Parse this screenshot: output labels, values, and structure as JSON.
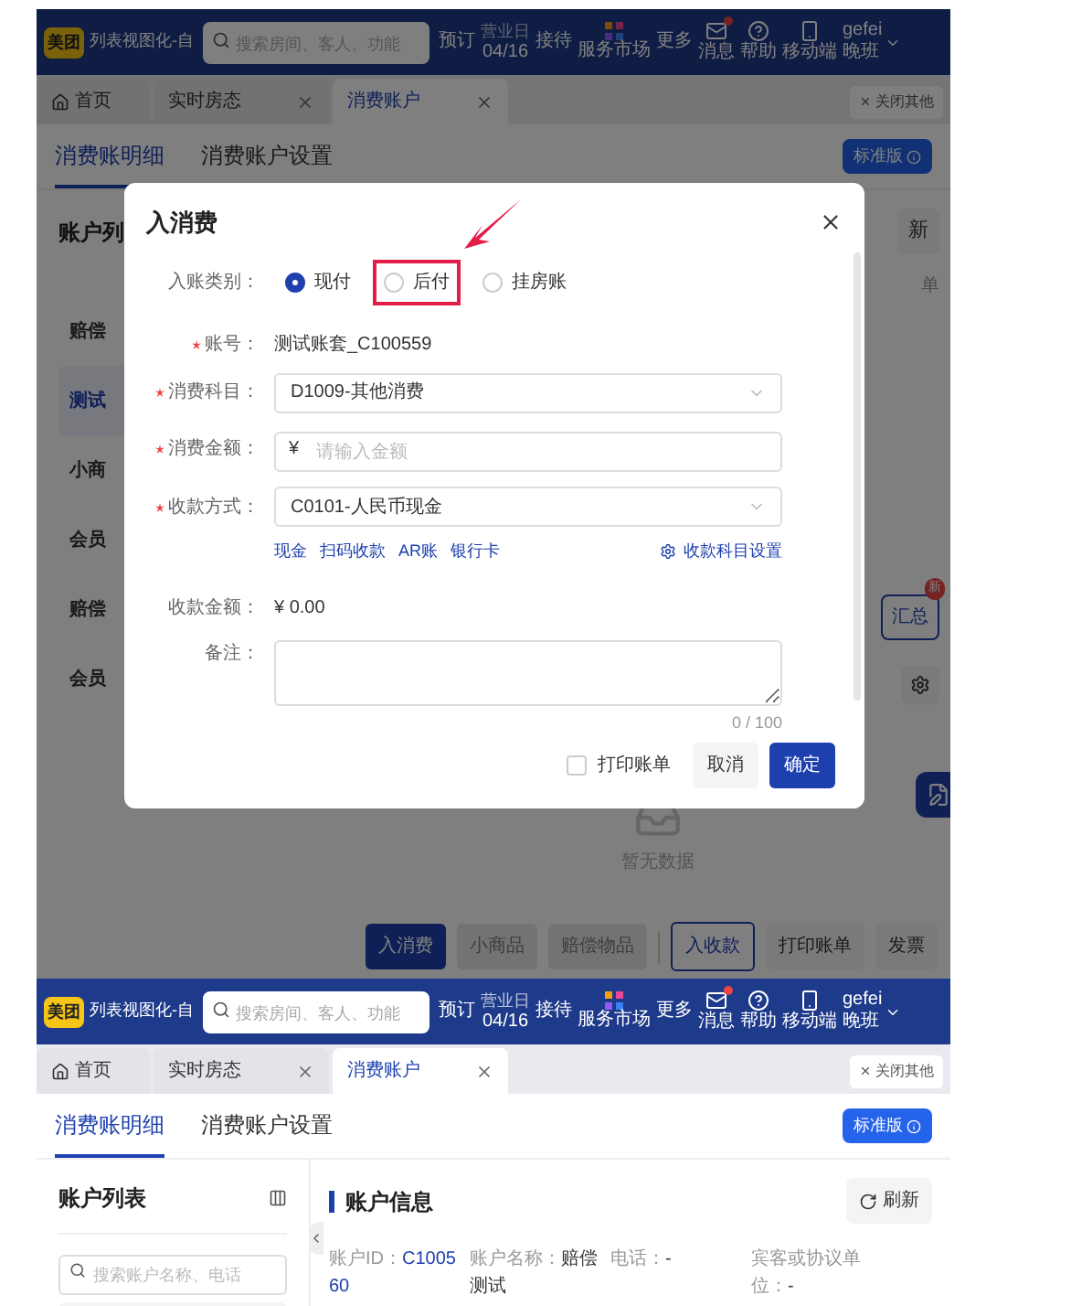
{
  "top_screen": {
    "header": {
      "logo": "美团",
      "title": "列表视图化-自",
      "search": {
        "placeholder": "搜索房间、客人、功能"
      },
      "items": [
        {
          "kind": "text",
          "label": "预订"
        },
        {
          "kind": "stack",
          "top": "营业日",
          "bottom": "04/16"
        },
        {
          "kind": "text",
          "label": "接待"
        },
        {
          "kind": "market",
          "label": "服务市场"
        },
        {
          "kind": "text",
          "label": "更多"
        },
        {
          "kind": "mail",
          "label": "消息",
          "unread": true
        },
        {
          "kind": "help",
          "label": "帮助"
        },
        {
          "kind": "phone",
          "label": "移动端"
        },
        {
          "kind": "user",
          "top": "gefei",
          "bottom": "晚班"
        }
      ]
    },
    "tabs": [
      {
        "kind": "home",
        "label": "首页",
        "selected": false,
        "closable": false
      },
      {
        "kind": "page",
        "label": "实时房态",
        "selected": false,
        "closable": true
      },
      {
        "kind": "page",
        "label": "消费账户",
        "selected": true,
        "closable": true
      }
    ],
    "close_others": "关闭其他",
    "subtabs": [
      {
        "label": "消费账明细",
        "selected": true
      },
      {
        "label": "消费账户设置",
        "selected": false
      }
    ],
    "edition_badge": "标准版",
    "account_list": {
      "title": "账户列",
      "items": [
        {
          "label": "赔偿",
          "selected": false
        },
        {
          "label": "测试",
          "selected": true
        },
        {
          "label": "小商",
          "selected": false
        },
        {
          "label": "会员",
          "selected": false
        },
        {
          "label": "赔偿",
          "selected": false
        },
        {
          "label": "会员",
          "selected": false
        }
      ]
    },
    "right_fragments": {
      "refresh": "新",
      "row_text": "单",
      "summary": {
        "label": "汇总",
        "badge": "新"
      }
    },
    "empty_text": "暂无数据",
    "actions": [
      {
        "label": "入消费",
        "kind": "primary"
      },
      {
        "label": "小商品",
        "kind": "disabled"
      },
      {
        "label": "赔偿物品",
        "kind": "disabled"
      },
      {
        "label": "入收款",
        "kind": "outline"
      },
      {
        "label": "打印账单",
        "kind": "default"
      },
      {
        "label": "发票",
        "kind": "default"
      }
    ],
    "modal": {
      "title": "入消费",
      "fields": [
        {
          "kind": "radio",
          "label": "入账类别：",
          "required": false,
          "options": [
            {
              "label": "现付",
              "selected": true,
              "highlighted": false
            },
            {
              "label": "后付",
              "selected": false,
              "highlighted": true
            },
            {
              "label": "挂房账",
              "selected": false,
              "highlighted": false
            }
          ]
        },
        {
          "kind": "text",
          "label": "账号：",
          "required": true,
          "value": "测试账套_C100559"
        },
        {
          "kind": "select",
          "label": "消费科目：",
          "required": true,
          "value": "D1009-其他消费"
        },
        {
          "kind": "amount",
          "label": "消费金额：",
          "required": true,
          "prefix": "¥",
          "placeholder": "请输入金额"
        },
        {
          "kind": "select",
          "label": "收款方式：",
          "required": true,
          "value": "C0101-人民币现金",
          "quick_links": [
            "现金",
            "扫码收款",
            "AR账",
            "银行卡"
          ],
          "settings_link": "收款科目设置"
        },
        {
          "kind": "text",
          "label": "收款金额：",
          "required": false,
          "value": "¥ 0.00"
        },
        {
          "kind": "textarea",
          "label": "备注：",
          "required": false,
          "counter": "0 / 100"
        }
      ],
      "print": {
        "label": "打印账单",
        "checked": false
      },
      "cancel": "取消",
      "confirm": "确定"
    }
  },
  "bottom_screen": {
    "header": {
      "logo": "美团",
      "title": "列表视图化-自",
      "search": {
        "placeholder": "搜索房间、客人、功能"
      },
      "items": [
        {
          "kind": "text",
          "label": "预订"
        },
        {
          "kind": "stack",
          "top": "营业日",
          "bottom": "04/16"
        },
        {
          "kind": "text",
          "label": "接待"
        },
        {
          "kind": "market",
          "label": "服务市场"
        },
        {
          "kind": "text",
          "label": "更多"
        },
        {
          "kind": "mail",
          "label": "消息",
          "unread": true
        },
        {
          "kind": "help",
          "label": "帮助"
        },
        {
          "kind": "phone",
          "label": "移动端"
        },
        {
          "kind": "user",
          "top": "gefei",
          "bottom": "晚班"
        }
      ]
    },
    "tabs": [
      {
        "kind": "home",
        "label": "首页",
        "selected": false,
        "closable": false
      },
      {
        "kind": "page",
        "label": "实时房态",
        "selected": false,
        "closable": true
      },
      {
        "kind": "page",
        "label": "消费账户",
        "selected": true,
        "closable": true
      }
    ],
    "close_others": "关闭其他",
    "subtabs": [
      {
        "label": "消费账明细",
        "selected": true
      },
      {
        "label": "消费账户设置",
        "selected": false
      }
    ],
    "edition_badge": "标准版",
    "account_list": {
      "title": "账户列表",
      "search_placeholder": "搜索账户名称、电话"
    },
    "account_info": {
      "title": "账户信息",
      "refresh": "刷新",
      "fields": [
        {
          "label": "账户ID：",
          "value": "C100560",
          "link": true
        },
        {
          "label": "账户名称：",
          "value": "赔偿测试",
          "link": false
        },
        {
          "label": "电话：",
          "value": "-",
          "link": false
        },
        {
          "label": "宾客或协议单位：",
          "value": "-",
          "link": false
        }
      ]
    }
  }
}
